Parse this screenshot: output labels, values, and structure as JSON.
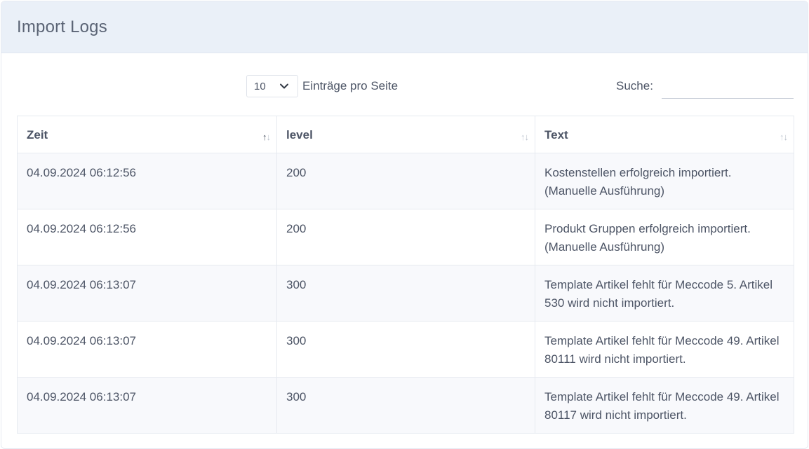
{
  "header": {
    "title": "Import Logs"
  },
  "toolbar": {
    "length_value": "10",
    "length_label": "Einträge pro Seite",
    "search_label": "Suche:",
    "search_value": ""
  },
  "icons": {
    "chevron": "chevron-down-icon",
    "sort": "sort-arrows-icon"
  },
  "table": {
    "columns": [
      {
        "label": "Zeit",
        "sort": "asc"
      },
      {
        "label": "level",
        "sort": "none"
      },
      {
        "label": "Text",
        "sort": "none"
      }
    ],
    "rows": [
      {
        "zeit": "04.09.2024 06:12:56",
        "level": "200",
        "text": "Kostenstellen erfolgreich importiert. (Manuelle Ausführung)"
      },
      {
        "zeit": "04.09.2024 06:12:56",
        "level": "200",
        "text": "Produkt Gruppen erfolgreich importiert. (Manuelle Ausführung)"
      },
      {
        "zeit": "04.09.2024 06:13:07",
        "level": "300",
        "text": "Template Artikel fehlt für Meccode 5. Artikel 530 wird nicht importiert."
      },
      {
        "zeit": "04.09.2024 06:13:07",
        "level": "300",
        "text": "Template Artikel fehlt für Meccode 49. Artikel 80111 wird nicht importiert."
      },
      {
        "zeit": "04.09.2024 06:13:07",
        "level": "300",
        "text": "Template Artikel fehlt für Meccode 49. Artikel 80117 wird nicht importiert."
      }
    ]
  }
}
